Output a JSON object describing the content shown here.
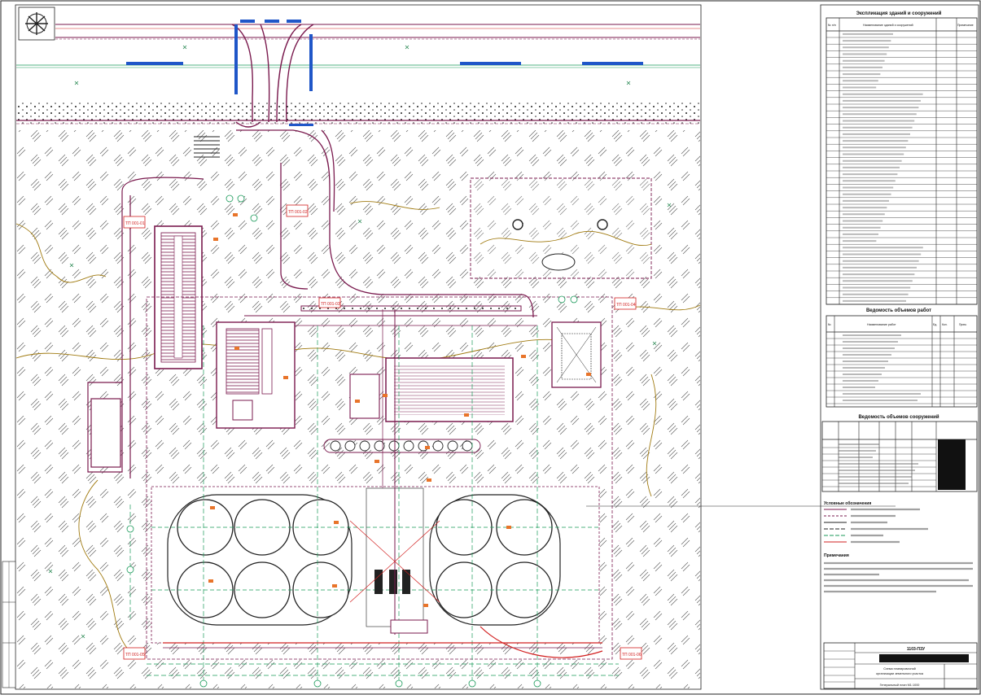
{
  "colors": {
    "building": "#7a1a4e",
    "road": "#7a1a4e",
    "accent_blue": "#1f56c8",
    "grass": "#2e8b57",
    "contour": "#a07a10",
    "redline": "#d22020",
    "tag": "#e8742a",
    "grid": "#1a9a5a"
  },
  "site_labels": {
    "tag_1": "ТП 001-01",
    "tag_2": "ТП 001-02",
    "tag_3": "ТП 001-03",
    "tag_4": "ТП 001-04",
    "tag_5": "ТП 001-05",
    "tag_6": "ТП 001-06"
  },
  "title_block": {
    "project_code": "1103-ПЗУ",
    "sheet_title_line1": "Схема планировочной",
    "sheet_title_line2": "организации земельного участка",
    "scale_note": "Генеральный план М1:1000"
  },
  "tables": {
    "explication": {
      "title": "Экспликация зданий и сооружений",
      "headers": [
        "№ п/п",
        "Наименование зданий и сооружений",
        "Примечание"
      ]
    },
    "volumes": {
      "title": "Ведомость объемов работ",
      "headers": [
        "№",
        "Наименование работ",
        "Ед.",
        "Кол.",
        "Прим."
      ]
    },
    "structures": {
      "title": "Ведомость объемов сооружений"
    }
  },
  "legend": {
    "title": "Условные обозначения"
  },
  "notes": {
    "title": "Примечания"
  }
}
